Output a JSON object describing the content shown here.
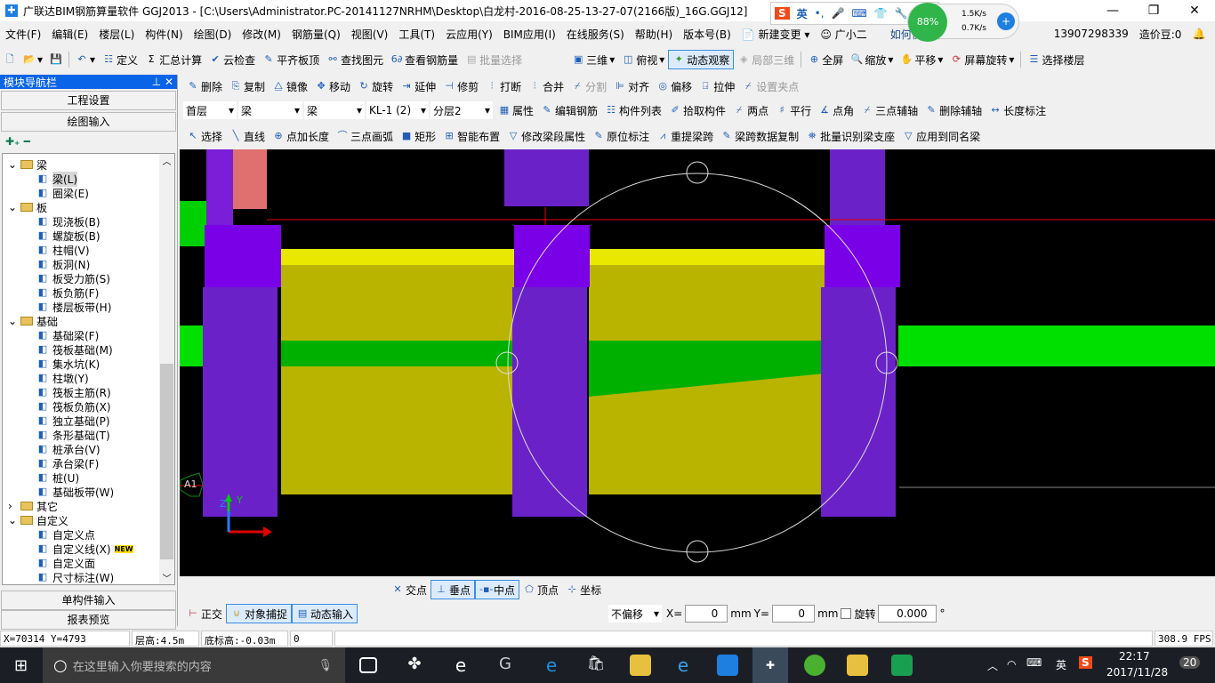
{
  "title": "广联达BIM钢筋算量软件 GGJ2013 - [C:\\Users\\Administrator.PC-20141127NRHM\\Desktop\\白龙村-2016-08-25-13-27-07(2166版)_16G.GGJ12]",
  "ime": {
    "lang": "英",
    "punct": "•,"
  },
  "net": {
    "percent": "88%",
    "up": "1.5K/s",
    "down": "0.7K/s"
  },
  "menu": [
    "文件(F)",
    "编辑(E)",
    "楼层(L)",
    "构件(N)",
    "绘图(D)",
    "修改(M)",
    "钢筋量(Q)",
    "视图(V)",
    "工具(T)",
    "云应用(Y)",
    "BIM应用(I)",
    "在线服务(S)",
    "帮助(H)",
    "版本号(B)"
  ],
  "menu_extra": {
    "new_change": "新建变更",
    "assistant": "广小二",
    "tip": "如何快速布",
    "phone": "13907298339",
    "beans": "造价豆:0"
  },
  "toolbar1": [
    "定义",
    "汇总计算",
    "云检查",
    "平齐板顶",
    "查找图元",
    "查看钢筋量",
    "批量选择"
  ],
  "toolbar1b": [
    "三维",
    "俯视",
    "动态观察",
    "局部三维",
    "全屏",
    "缩放",
    "平移",
    "屏幕旋转",
    "选择楼层"
  ],
  "toolbar2": [
    "删除",
    "复制",
    "镜像",
    "移动",
    "旋转",
    "延伸",
    "修剪",
    "打断",
    "合并",
    "分割",
    "对齐",
    "偏移",
    "拉伸",
    "设置夹点"
  ],
  "selectors": {
    "floor": "首层",
    "type": "梁",
    "sub": "梁",
    "component": "KL-1 (2)",
    "layer": "分层2"
  },
  "toolbar3": [
    "属性",
    "编辑钢筋",
    "构件列表",
    "拾取构件",
    "两点",
    "平行",
    "点角",
    "三点辅轴",
    "删除辅轴",
    "长度标注"
  ],
  "toolbar4": [
    "选择",
    "直线",
    "点加长度",
    "三点画弧",
    "矩形",
    "智能布置",
    "修改梁段属性",
    "原位标注",
    "重提梁跨",
    "梁跨数据复制",
    "批量识别梁支座",
    "应用到同名梁"
  ],
  "nav": {
    "title": "模块导航栏",
    "btn_project": "工程设置",
    "btn_draw": "绘图输入",
    "btn_single": "单构件输入",
    "btn_report": "报表预览",
    "tree": [
      {
        "label": "梁",
        "folder": true
      },
      {
        "label": "梁(L)",
        "selected": true
      },
      {
        "label": "圈梁(E)"
      },
      {
        "label": "板",
        "folder": true
      },
      {
        "label": "现浇板(B)"
      },
      {
        "label": "螺旋板(B)"
      },
      {
        "label": "柱帽(V)"
      },
      {
        "label": "板洞(N)"
      },
      {
        "label": "板受力筋(S)"
      },
      {
        "label": "板负筋(F)"
      },
      {
        "label": "楼层板带(H)"
      },
      {
        "label": "基础",
        "folder": true
      },
      {
        "label": "基础梁(F)"
      },
      {
        "label": "筏板基础(M)"
      },
      {
        "label": "集水坑(K)"
      },
      {
        "label": "柱墩(Y)"
      },
      {
        "label": "筏板主筋(R)"
      },
      {
        "label": "筏板负筋(X)"
      },
      {
        "label": "独立基础(P)"
      },
      {
        "label": "条形基础(T)"
      },
      {
        "label": "桩承台(V)"
      },
      {
        "label": "承台梁(F)"
      },
      {
        "label": "桩(U)"
      },
      {
        "label": "基础板带(W)"
      },
      {
        "label": "其它",
        "folder": true,
        "collapsed": true
      },
      {
        "label": "自定义",
        "folder": true
      },
      {
        "label": "自定义点"
      },
      {
        "label": "自定义线(X)",
        "badge": "NEW"
      },
      {
        "label": "自定义面"
      },
      {
        "label": "尺寸标注(W)"
      }
    ]
  },
  "viewport": {
    "axis_label": "A1",
    "axis_y": "Y",
    "axis_z": "Z"
  },
  "snap": [
    "交点",
    "垂点",
    "中点",
    "顶点",
    "坐标"
  ],
  "bottom": {
    "ortho": "正交",
    "osnap": "对象捕捉",
    "dyn": "动态输入",
    "offset": "不偏移",
    "x_label": "X=",
    "x": "0",
    "y_label": "Y=",
    "y": "0",
    "unit": "mm",
    "rotate": "旋转",
    "angle": "0.000",
    "deg": "°"
  },
  "status": {
    "coords": "X=70314 Y=4793",
    "floor_h": "层高:4.5m",
    "base_h": "底标高:-0.03m",
    "val": "0",
    "fps": "308.9 FPS"
  },
  "taskbar": {
    "search": "在这里输入你要搜索的内容",
    "ime": "英",
    "time": "22:17",
    "date": "2017/11/28",
    "notif": "20"
  }
}
